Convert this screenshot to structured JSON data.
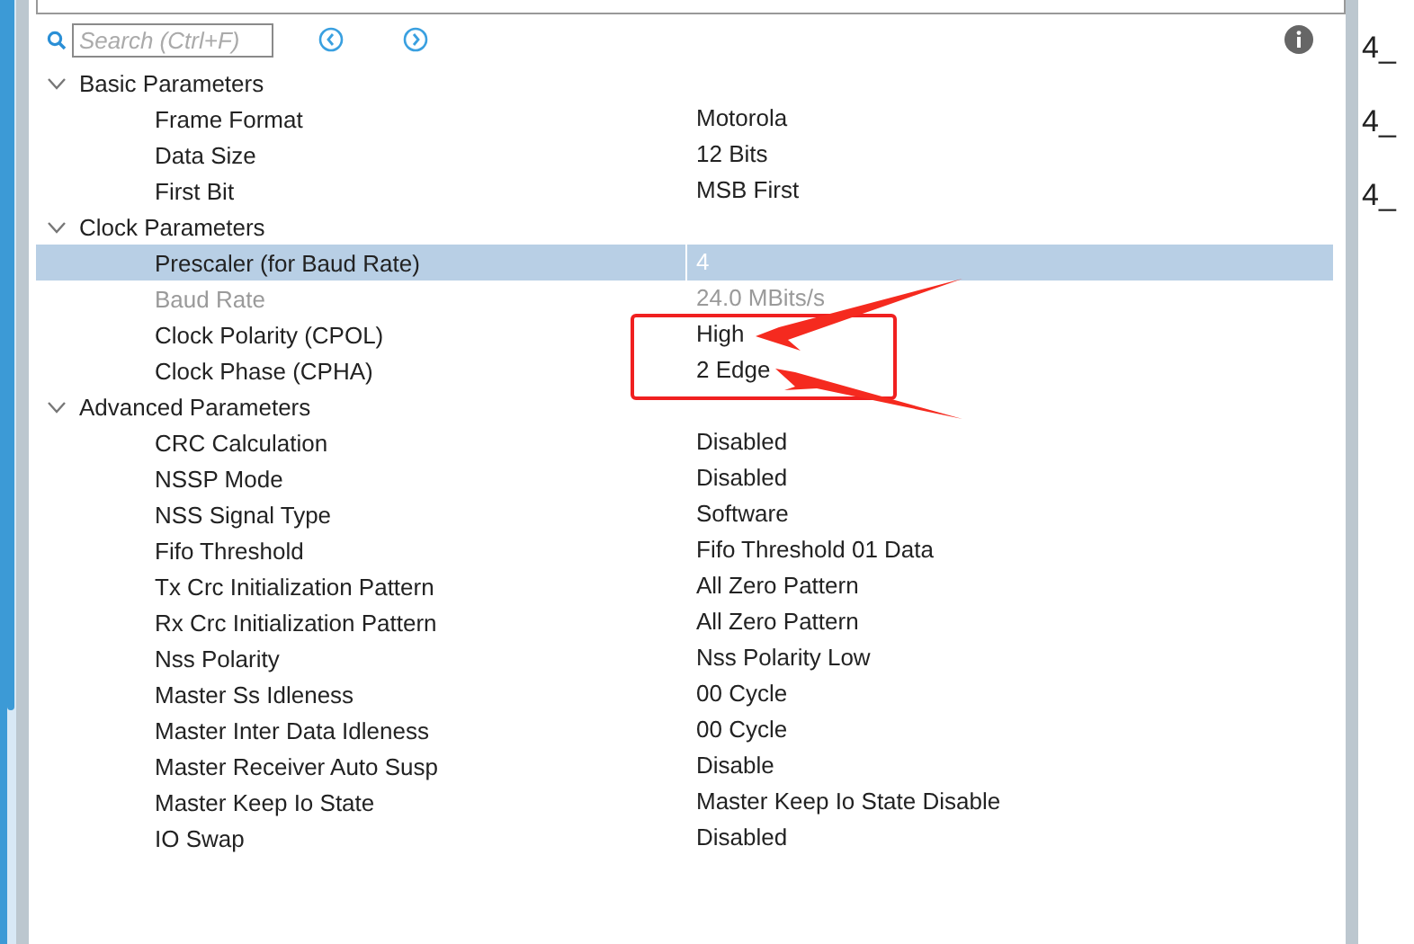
{
  "search": {
    "placeholder": "Search (Ctrl+F)"
  },
  "groups": [
    {
      "title": "Basic Parameters",
      "expanded": true,
      "params": [
        {
          "name": "Frame Format",
          "value": "Motorola",
          "selected": false,
          "disabled": false
        },
        {
          "name": "Data Size",
          "value": "12 Bits",
          "selected": false,
          "disabled": false
        },
        {
          "name": "First Bit",
          "value": "MSB First",
          "selected": false,
          "disabled": false
        }
      ]
    },
    {
      "title": "Clock Parameters",
      "expanded": true,
      "params": [
        {
          "name": "Prescaler (for Baud Rate)",
          "value": "4",
          "selected": true,
          "disabled": false
        },
        {
          "name": "Baud Rate",
          "value": "24.0 MBits/s",
          "selected": false,
          "disabled": true
        },
        {
          "name": "Clock Polarity (CPOL)",
          "value": "High",
          "selected": false,
          "disabled": false
        },
        {
          "name": "Clock Phase (CPHA)",
          "value": "2 Edge",
          "selected": false,
          "disabled": false
        }
      ]
    },
    {
      "title": "Advanced Parameters",
      "expanded": true,
      "params": [
        {
          "name": "CRC Calculation",
          "value": "Disabled",
          "selected": false,
          "disabled": false
        },
        {
          "name": "NSSP Mode",
          "value": "Disabled",
          "selected": false,
          "disabled": false
        },
        {
          "name": "NSS Signal Type",
          "value": "Software",
          "selected": false,
          "disabled": false
        },
        {
          "name": "Fifo Threshold",
          "value": "Fifo Threshold 01 Data",
          "selected": false,
          "disabled": false
        },
        {
          "name": "Tx Crc Initialization Pattern",
          "value": "All Zero Pattern",
          "selected": false,
          "disabled": false
        },
        {
          "name": "Rx Crc Initialization Pattern",
          "value": "All Zero Pattern",
          "selected": false,
          "disabled": false
        },
        {
          "name": "Nss Polarity",
          "value": "Nss Polarity Low",
          "selected": false,
          "disabled": false
        },
        {
          "name": "Master Ss Idleness",
          "value": "00 Cycle",
          "selected": false,
          "disabled": false
        },
        {
          "name": "Master Inter Data Idleness",
          "value": "00 Cycle",
          "selected": false,
          "disabled": false
        },
        {
          "name": "Master Receiver Auto Susp",
          "value": "Disable",
          "selected": false,
          "disabled": false
        },
        {
          "name": "Master Keep Io State",
          "value": "Master Keep Io State Disable",
          "selected": false,
          "disabled": false
        },
        {
          "name": "IO Swap",
          "value": "Disabled",
          "selected": false,
          "disabled": false
        }
      ]
    }
  ],
  "side_fragments": [
    "4_",
    "4_",
    "4_"
  ]
}
